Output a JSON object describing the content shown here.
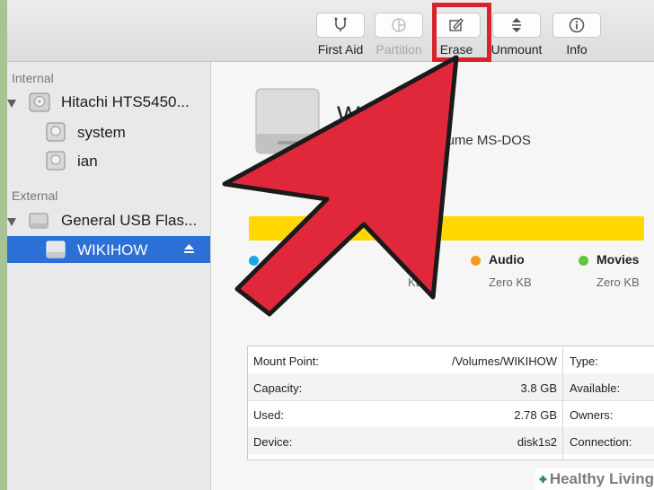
{
  "toolbar": {
    "buttons": [
      {
        "label": "First Aid",
        "icon": "first-aid-icon"
      },
      {
        "label": "Partition",
        "icon": "partition-icon",
        "disabled": true
      },
      {
        "label": "Erase",
        "icon": "erase-icon"
      },
      {
        "label": "Unmount",
        "icon": "unmount-icon"
      },
      {
        "label": "Info",
        "icon": "info-icon"
      }
    ]
  },
  "sidebar": {
    "internal_label": "Internal",
    "external_label": "External",
    "internal_disk": "Hitachi HTS5450...",
    "internal_volumes": [
      "system",
      "ian"
    ],
    "external_disk": "General USB Flas...",
    "selected_volume": "WIKIHOW"
  },
  "main": {
    "volume_title": "WIKIHOW",
    "volume_subtitle": "ternal Physical Volume MS-DOS",
    "legend": [
      {
        "name": "",
        "size": "",
        "color": "#1aa7e8"
      },
      {
        "name": "s",
        "size": "KB",
        "color": "#e23a3a"
      },
      {
        "name": "Audio",
        "size": "Zero KB",
        "color": "#f59a1b"
      },
      {
        "name": "Movies",
        "size": "Zero KB",
        "color": "#5cc83c"
      }
    ],
    "usage_bar_color": "#ffd800",
    "info_rows": [
      {
        "label": "Mount Point:",
        "value": "/Volumes/WIKIHOW",
        "label2": "Type:"
      },
      {
        "label": "Capacity:",
        "value": "3.8 GB",
        "label2": "Available:"
      },
      {
        "label": "Used:",
        "value": "2.78 GB",
        "label2": "Owners:"
      },
      {
        "label": "Device:",
        "value": "disk1s2",
        "label2": "Connection:"
      }
    ]
  },
  "annotation": {
    "color": "#d8222e",
    "target": "Erase"
  },
  "watermark": {
    "text": "Healthy Living",
    "icon": "plus-leaf-icon"
  }
}
